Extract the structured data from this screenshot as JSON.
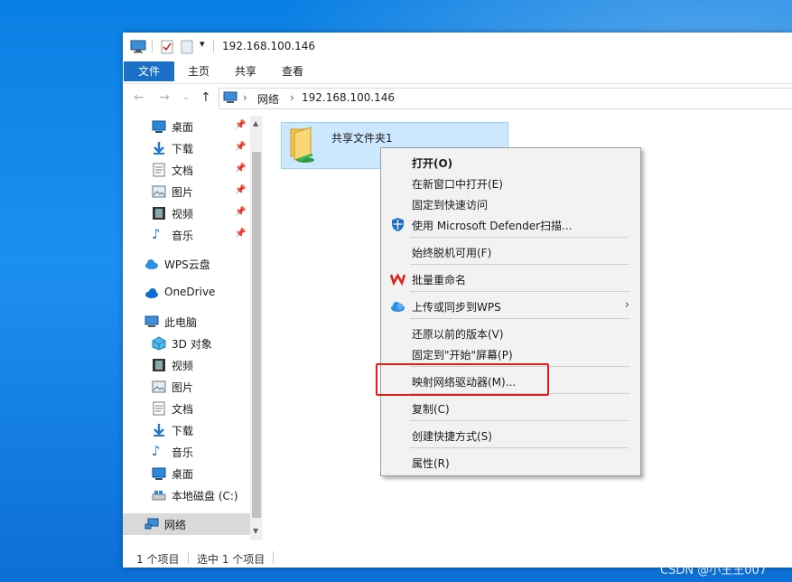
{
  "window": {
    "title": "192.168.100.146",
    "ribbon_tabs": [
      "文件",
      "主页",
      "共享",
      "查看"
    ],
    "address": {
      "crumbs": [
        "网络",
        "192.168.100.146"
      ]
    }
  },
  "nav": {
    "quick_access": [
      {
        "label": "桌面",
        "icon": "desktop-icon"
      },
      {
        "label": "下载",
        "icon": "download-icon"
      },
      {
        "label": "文档",
        "icon": "document-icon"
      },
      {
        "label": "图片",
        "icon": "picture-icon"
      },
      {
        "label": "视频",
        "icon": "video-icon"
      },
      {
        "label": "音乐",
        "icon": "music-icon"
      }
    ],
    "wps_cloud": "WPS云盘",
    "onedrive": "OneDrive",
    "this_pc": "此电脑",
    "pc_items": [
      {
        "label": "3D 对象",
        "icon": "3d-objects-icon"
      },
      {
        "label": "视频",
        "icon": "video-icon"
      },
      {
        "label": "图片",
        "icon": "picture-icon"
      },
      {
        "label": "文档",
        "icon": "document-icon"
      },
      {
        "label": "下载",
        "icon": "download-icon"
      },
      {
        "label": "音乐",
        "icon": "music-icon"
      },
      {
        "label": "桌面",
        "icon": "desktop-icon"
      },
      {
        "label": "本地磁盘 (C:)",
        "icon": "drive-icon"
      }
    ],
    "network": "网络"
  },
  "content": {
    "folder": {
      "label": "共享文件夹1",
      "icon": "shared-folder-icon"
    }
  },
  "status": {
    "count": "1 个项目",
    "selected": "选中 1 个项目"
  },
  "context_menu": {
    "items": [
      "打开(O)",
      "在新窗口中打开(E)",
      "固定到快速访问",
      "使用 Microsoft Defender扫描...",
      "始终脱机可用(F)",
      "批量重命名",
      "上传或同步到WPS",
      "还原以前的版本(V)",
      "固定到\"开始\"屏幕(P)",
      "映射网络驱动器(M)...",
      "复制(C)",
      "创建快捷方式(S)",
      "属性(R)"
    ],
    "highlighted": "映射网络驱动器(M)..."
  },
  "colors": {
    "accent": "#1a6fc7",
    "selection": "#cce8ff",
    "highlight": "#e0201c"
  },
  "watermark": "CSDN @小王王007"
}
